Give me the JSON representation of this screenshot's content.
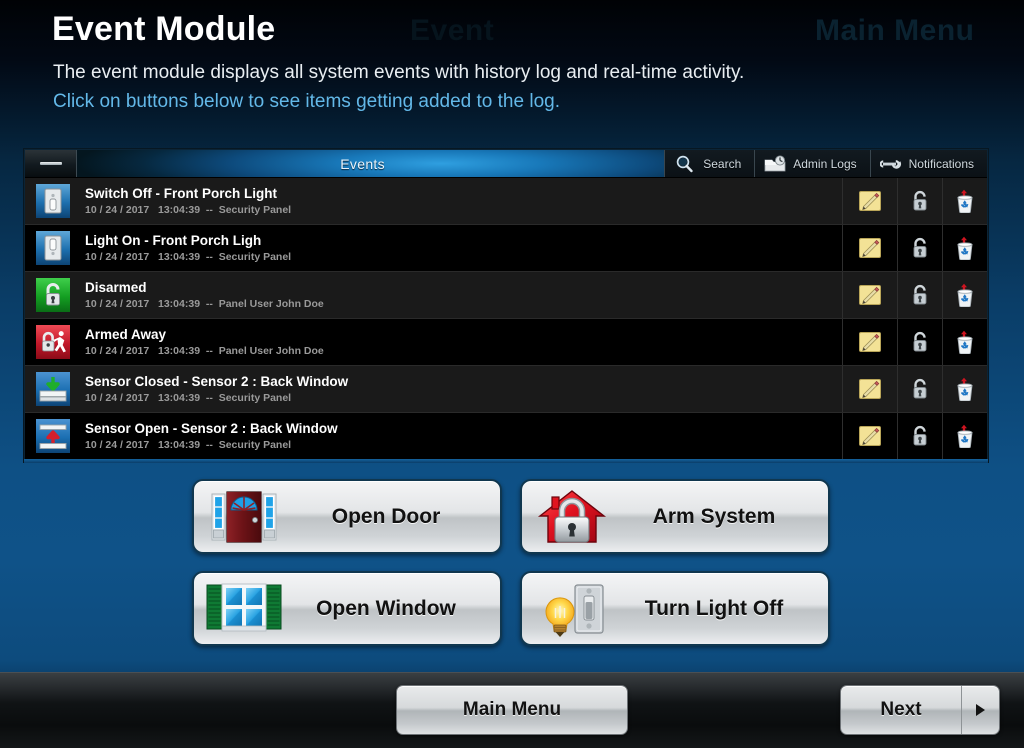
{
  "header": {
    "title": "Event Module",
    "subtitle_line1": "The event module displays all system events with history log and real-time activity.",
    "subtitle_line2": "Click on buttons below to see items getting added to the log.",
    "ghost_left": "Event",
    "ghost_right": "Main Menu"
  },
  "events_panel": {
    "minimize_label": "—",
    "active_tab": "Events",
    "tabs": [
      {
        "label": "Events",
        "icon": "none",
        "active": true
      },
      {
        "label": "Search",
        "icon": "magnifier-icon",
        "active": false
      },
      {
        "label": "Admin Logs",
        "icon": "folder-clock-icon",
        "active": false
      },
      {
        "label": "Notifications",
        "icon": "wrench-icon",
        "active": false
      }
    ],
    "row_actions": [
      {
        "name": "edit-note-icon",
        "label": "Edit"
      },
      {
        "name": "unlock-icon",
        "label": "Lock"
      },
      {
        "name": "recycle-bin-icon",
        "label": "Delete"
      }
    ],
    "rows": [
      {
        "icon": "light-switch-off-icon",
        "title": "Switch Off - Front Porch Light",
        "date": "10 / 24 / 2017",
        "time": "13:04:39",
        "separator": "--",
        "source": "Security Panel"
      },
      {
        "icon": "light-switch-on-icon",
        "title": "Light On - Front Porch Ligh",
        "date": "10 / 24 / 2017",
        "time": "13:04:39",
        "separator": "--",
        "source": "Security Panel"
      },
      {
        "icon": "disarmed-unlock-icon",
        "title": "Disarmed",
        "date": "10 / 24 / 2017",
        "time": "13:04:39",
        "separator": "--",
        "source": "Panel User John Doe"
      },
      {
        "icon": "armed-away-icon",
        "title": "Armed Away",
        "date": "10 / 24 / 2017",
        "time": "13:04:39",
        "separator": "--",
        "source": "Panel User John Doe"
      },
      {
        "icon": "sensor-closed-icon",
        "title": "Sensor Closed - Sensor 2 : Back Window",
        "date": "10 / 24 / 2017",
        "time": "13:04:39",
        "separator": "--",
        "source": "Security Panel"
      },
      {
        "icon": "sensor-open-icon",
        "title": "Sensor Open - Sensor 2 : Back Window",
        "date": "10 / 24 / 2017",
        "time": "13:04:39",
        "separator": "--",
        "source": "Security Panel"
      }
    ]
  },
  "action_buttons": [
    {
      "id": "open-door",
      "label": "Open Door",
      "icon": "front-door-icon"
    },
    {
      "id": "arm-system",
      "label": "Arm System",
      "icon": "house-lock-icon"
    },
    {
      "id": "open-window",
      "label": "Open Window",
      "icon": "shuttered-window-icon"
    },
    {
      "id": "turn-light",
      "label": "Turn Light Off",
      "icon": "bulb-switch-icon"
    }
  ],
  "footer": {
    "main_menu_label": "Main Menu",
    "next_label": "Next",
    "next_arrow_icon": "chevron-right-icon"
  },
  "colors": {
    "background_blue": "#0e5085",
    "accent_link": "#63b8e8",
    "tab_active_blue": "#1878b9",
    "row_odd": "#1a1a1a",
    "row_even": "#000000",
    "disarmed_green": "#1d9e27",
    "armed_red": "#c2182a",
    "sensor_blue": "#1b73c2",
    "button_face": "#dfe2e4"
  }
}
